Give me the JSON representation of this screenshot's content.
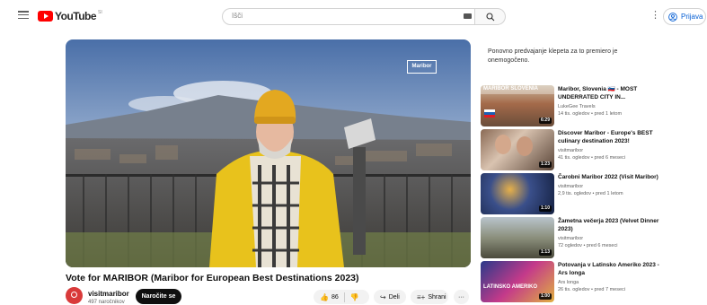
{
  "header": {
    "logo_text": "YouTube",
    "logo_region": "SI",
    "search_placeholder": "Išči",
    "signin_label": "Prijava",
    "more_label": "⋮"
  },
  "video": {
    "title": "Vote for MARIBOR (Maribor for European Best Destinations 2023)",
    "watermark": "Maribor",
    "channel": "visitmaribor",
    "subscribers": "497 naročnikov",
    "subscribe_label": "Naročite se",
    "likes": "86",
    "share_label": "Deli",
    "save_label": "Shrani",
    "more_label": "···"
  },
  "chat": {
    "message": "Ponovno predvajanje klepeta za to premiero je onemogočeno."
  },
  "recommendations": [
    {
      "title": "Maribor, Slovenia 🇸🇮 - MOST UNDERRATED CITY IN...",
      "channel": "LukeGee Travels",
      "meta": "14 tis. ogledov • pred 1 letom",
      "duration": "6:29",
      "thumb_text": "MARIBOR SLOVENIA"
    },
    {
      "title": "Discover Maribor - Europe's BEST culinary destination 2023!",
      "channel": "visitmaribor",
      "meta": "41 tis. ogledov • pred 6 meseci",
      "duration": "1:23",
      "thumb_text": ""
    },
    {
      "title": "Čarobni Maribor 2022 (Visit Maribor)",
      "channel": "visitmaribor",
      "meta": "2,9 tis. ogledov • pred 1 letom",
      "duration": "1:10",
      "thumb_text": ""
    },
    {
      "title": "Žametna večerja 2023 (Velvet Dinner 2023)",
      "channel": "visitmaribor",
      "meta": "72 ogledov • pred 6 meseci",
      "duration": "1:13",
      "thumb_text": ""
    },
    {
      "title": "Potovanja v Latinsko Ameriko 2023 - Ars longa",
      "channel": "Ars longa",
      "meta": "26 tis. ogledov • pred 7 meseci",
      "duration": "1:00",
      "thumb_text": "LATINSKO AMERIKO"
    }
  ]
}
